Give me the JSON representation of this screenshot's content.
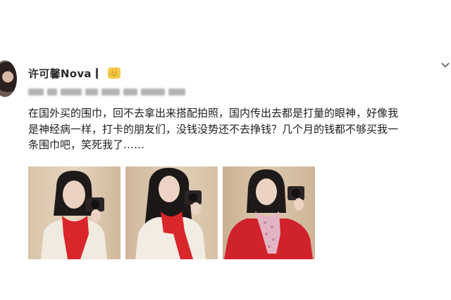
{
  "post": {
    "username": "许可馨Nova",
    "verified_badge": "👑",
    "text_lines": [
      "在国外买的围巾，回不去拿出来搭配拍照，国内传出去都是打量的眼神，好像我",
      "是神经病一样，打卡的朋友们，没钱没势还不去挣钱？几个月的钱都不够买我一",
      "条围巾吧，笑死我了……"
    ],
    "photos": [
      {
        "alt": "woman-with-red-scarf-cream-sweater"
      },
      {
        "alt": "woman-with-red-scarf-holding-camera"
      },
      {
        "alt": "woman-in-red-sweater-pink-scarf"
      }
    ]
  },
  "colors": {
    "text": "#1e1e1e",
    "scarf_red": "#d8262a",
    "background": "#ffffff"
  },
  "icons": {
    "more": "chevron-down-icon",
    "badge": "verified-icon"
  }
}
